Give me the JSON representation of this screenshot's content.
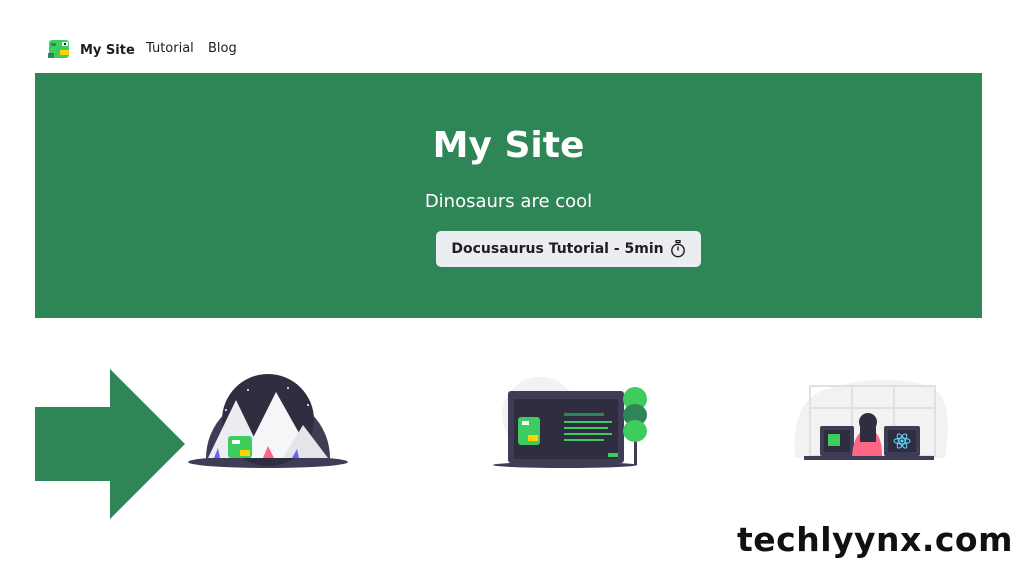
{
  "navbar": {
    "brand_title": "My Site",
    "links": [
      {
        "label": "Tutorial"
      },
      {
        "label": "Blog"
      }
    ]
  },
  "hero": {
    "title": "My Site",
    "subtitle": "Dinosaurs are cool",
    "button_label": "Docusaurus Tutorial - 5min",
    "button_icon": "timer-icon"
  },
  "features": [
    {
      "icon": "mountain-illustration"
    },
    {
      "icon": "tree-screen-illustration"
    },
    {
      "icon": "react-desk-illustration"
    }
  ],
  "overlay": {
    "arrow_icon": "right-arrow-icon",
    "watermark": "techlyynx.com"
  },
  "colors": {
    "primary": "#2e8555",
    "button_bg": "#ebedf0",
    "text": "#1c1e21"
  }
}
